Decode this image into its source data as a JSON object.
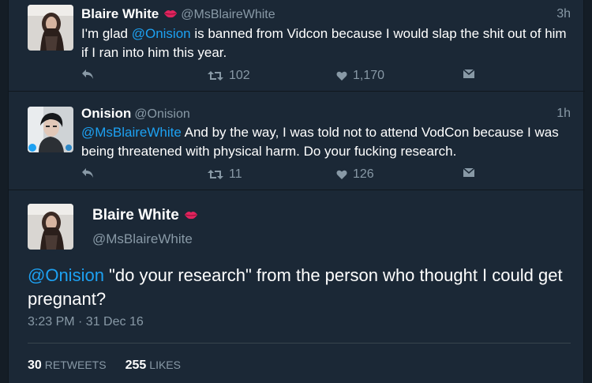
{
  "tweets": [
    {
      "name": "Blaire White",
      "handle": "@MsBlaireWhite",
      "time": "3h",
      "text_before": "I'm glad ",
      "mention": "@Onision",
      "text_after": " is banned from Vidcon because I would slap the shit out of him if I ran into him this year.",
      "retweets": "102",
      "likes": "1,170"
    },
    {
      "name": "Onision",
      "handle": "@Onision",
      "time": "1h",
      "mention": "@MsBlaireWhite",
      "text_after": " And by the way, I was told not to attend VodCon because I was being threatened with physical harm. Do your fucking research.",
      "retweets": "11",
      "likes": "126"
    }
  ],
  "focused": {
    "name": "Blaire White",
    "handle": "@MsBlaireWhite",
    "mention": "@Onision",
    "text_after": " \"do your research\" from the person who thought I could get pregnant?",
    "timestamp": "3:23 PM · 31 Dec 16",
    "retweets_count": "30",
    "retweets_label": "RETWEETS",
    "likes_count": "255",
    "likes_label": "LIKES"
  },
  "icons": {
    "reply": "reply-icon",
    "retweet": "retweet-icon",
    "like": "heart-icon",
    "dm": "direct-message-icon",
    "lips": "lips-emoji-icon"
  },
  "colors": {
    "background": "#141d26",
    "card": "#1b2836",
    "link": "#1da1f2",
    "muted": "#8899a6",
    "lips": "#e0245e"
  }
}
